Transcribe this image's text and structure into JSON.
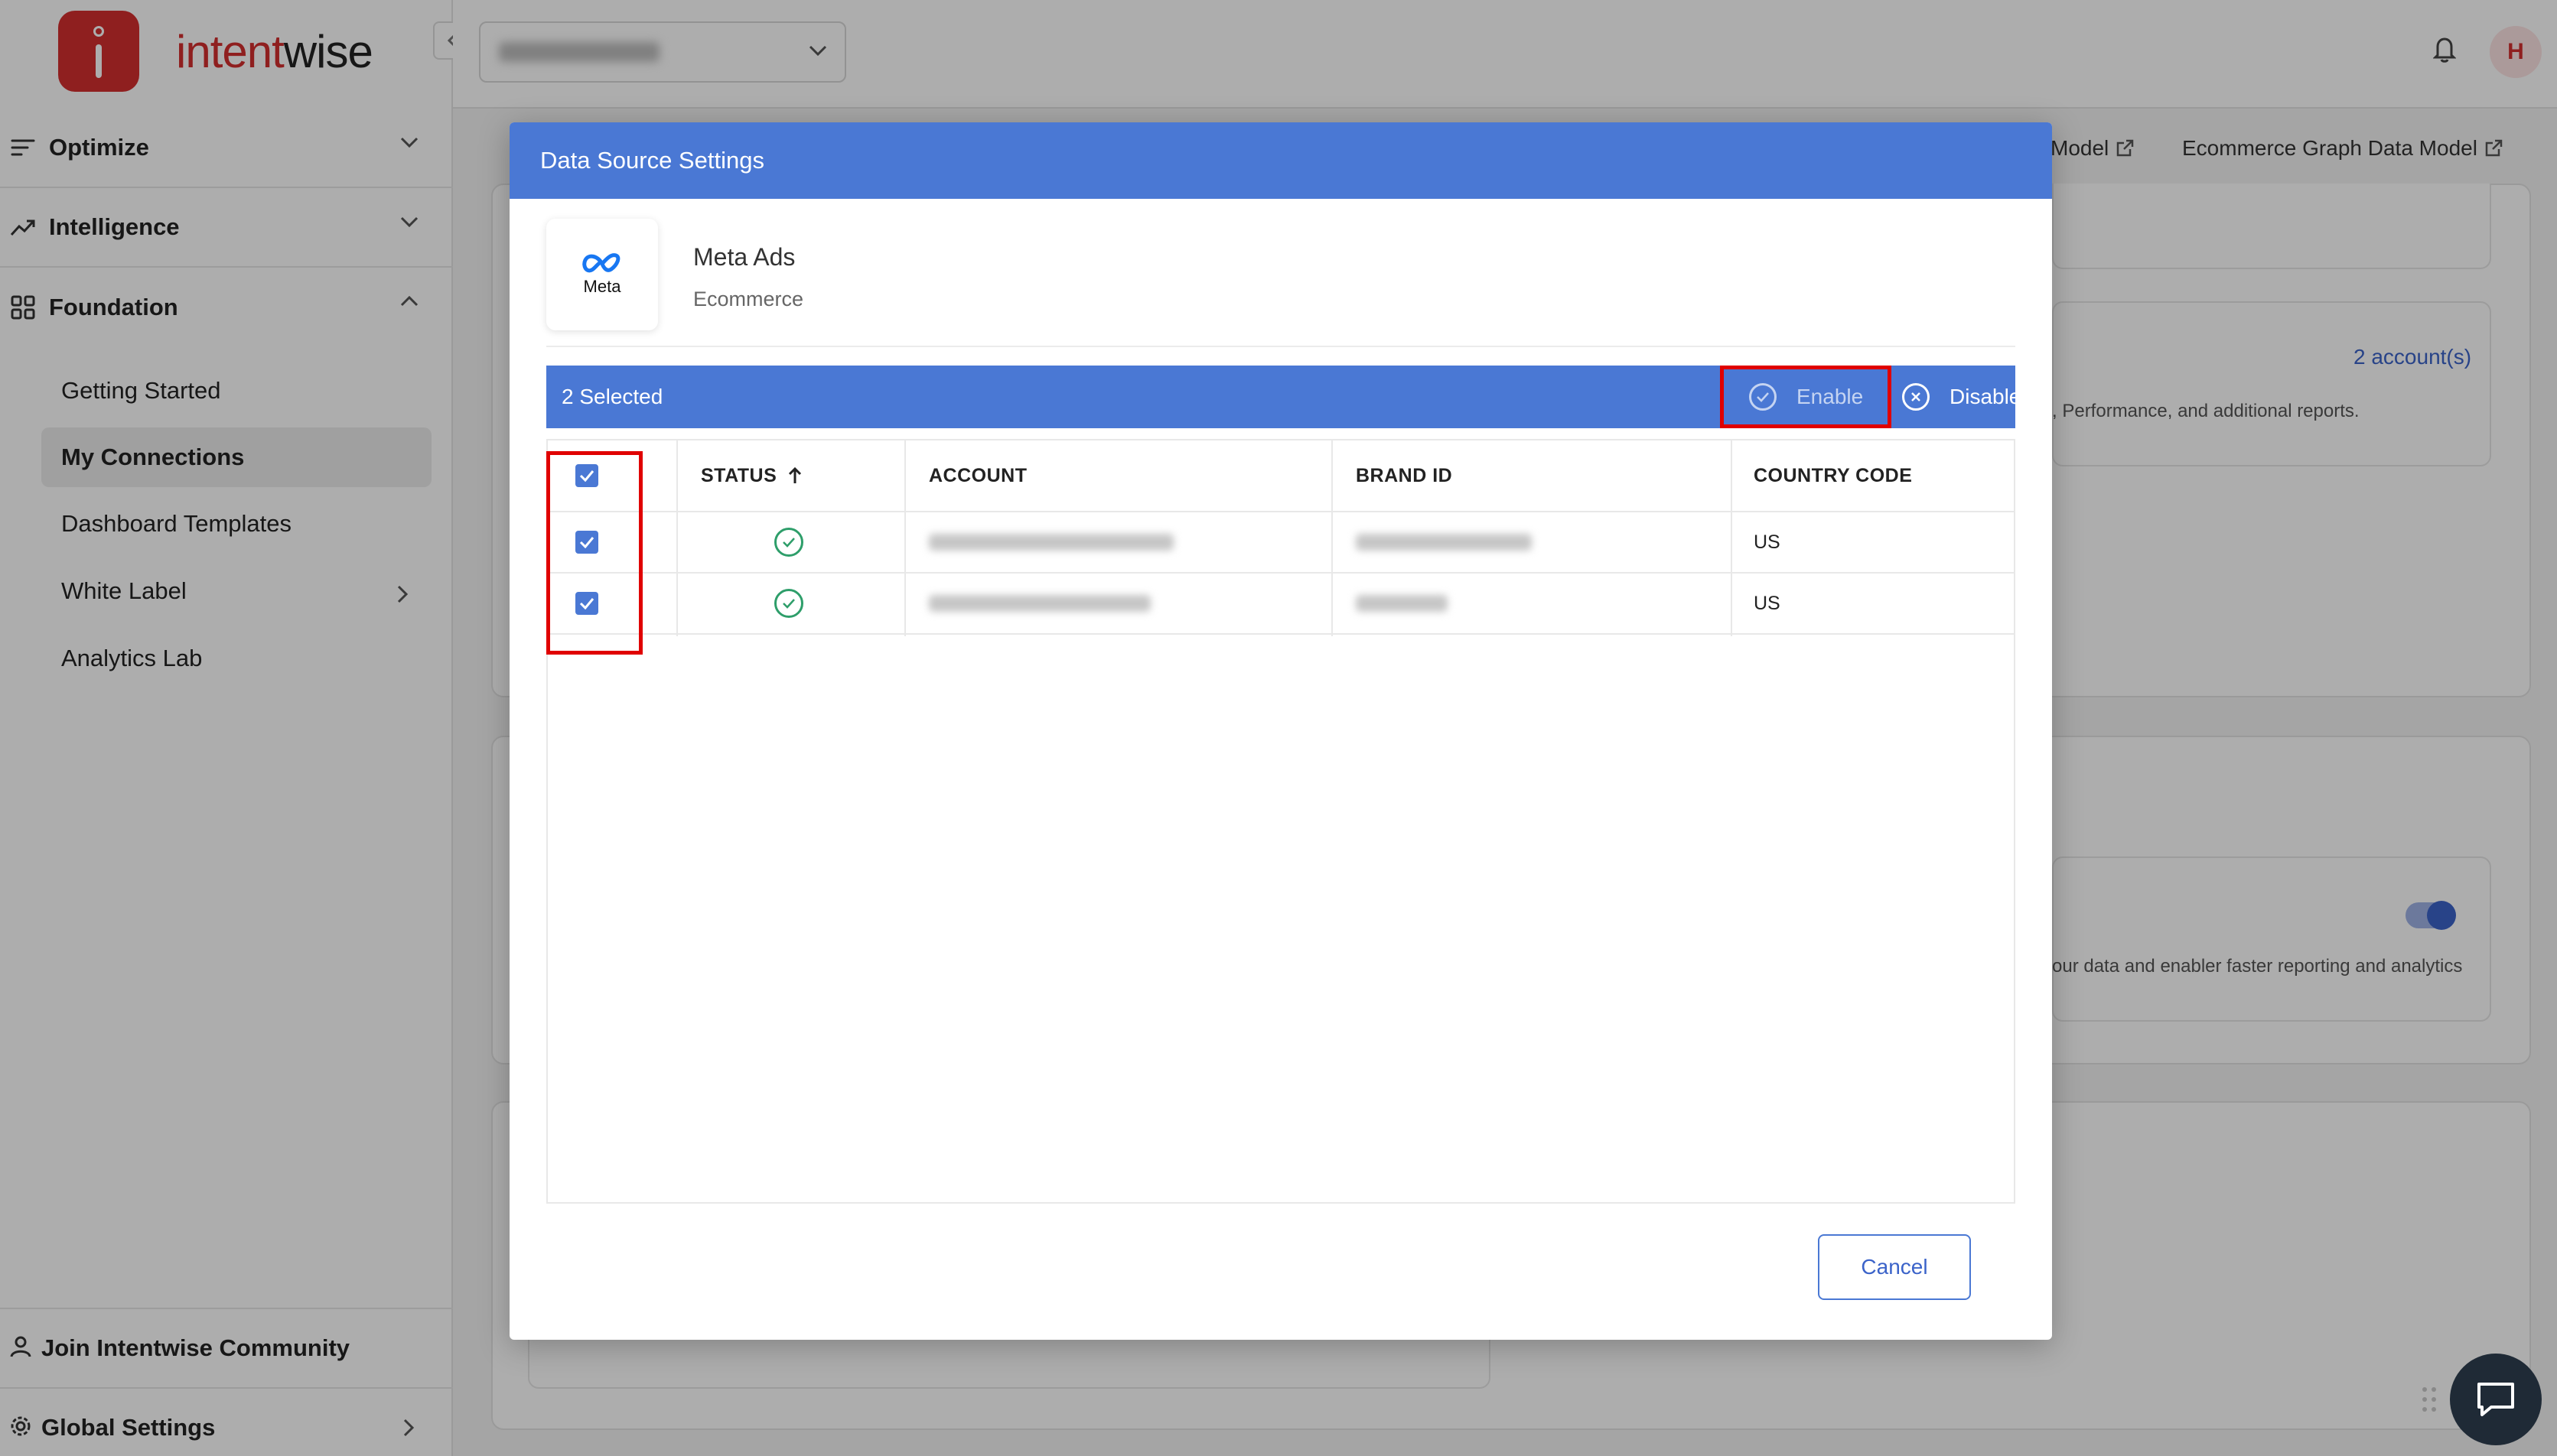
{
  "brand": {
    "name_left": "intent",
    "name_right": "wise"
  },
  "sidebar": {
    "sections": [
      {
        "label": "Optimize",
        "icon": "sliders-icon",
        "expanded": false
      },
      {
        "label": "Intelligence",
        "icon": "trend-up-icon",
        "expanded": false
      },
      {
        "label": "Foundation",
        "icon": "grid-icon",
        "expanded": true
      }
    ],
    "foundation_items": [
      {
        "label": "Getting Started"
      },
      {
        "label": "My Connections",
        "active": true
      },
      {
        "label": "Dashboard Templates"
      },
      {
        "label": "White Label",
        "has_submenu": true
      },
      {
        "label": "Analytics Lab"
      }
    ],
    "bottom": [
      {
        "label": "Join Intentwise Community",
        "icon": "user-icon"
      },
      {
        "label": "Global Settings",
        "icon": "gear-icon"
      }
    ]
  },
  "topbar": {
    "avatar_initial": "H"
  },
  "background": {
    "link_model": "Model",
    "link_graph": "Ecommerce Graph Data Model",
    "accounts_link": "2 account(s)",
    "desc_1": ", Performance, and additional reports.",
    "desc_2": "our data and enabler faster reporting and analytics"
  },
  "modal": {
    "title": "Data Source Settings",
    "source": {
      "name": "Meta Ads",
      "category": "Ecommerce",
      "logo_word": "Meta"
    },
    "selection": {
      "count_label": "2 Selected",
      "enable_label": "Enable",
      "disable_label": "Disable"
    },
    "table": {
      "columns": [
        "STATUS",
        "ACCOUNT",
        "BRAND ID",
        "COUNTRY CODE"
      ],
      "rows": [
        {
          "checked": true,
          "status": "active",
          "country_code": "US"
        },
        {
          "checked": true,
          "status": "active",
          "country_code": "US"
        }
      ]
    },
    "cancel_label": "Cancel"
  },
  "colors": {
    "accent": "#4a78d4",
    "brand_red": "#d32f2f",
    "highlight_red": "#e00000",
    "status_green": "#2e9e6a"
  }
}
